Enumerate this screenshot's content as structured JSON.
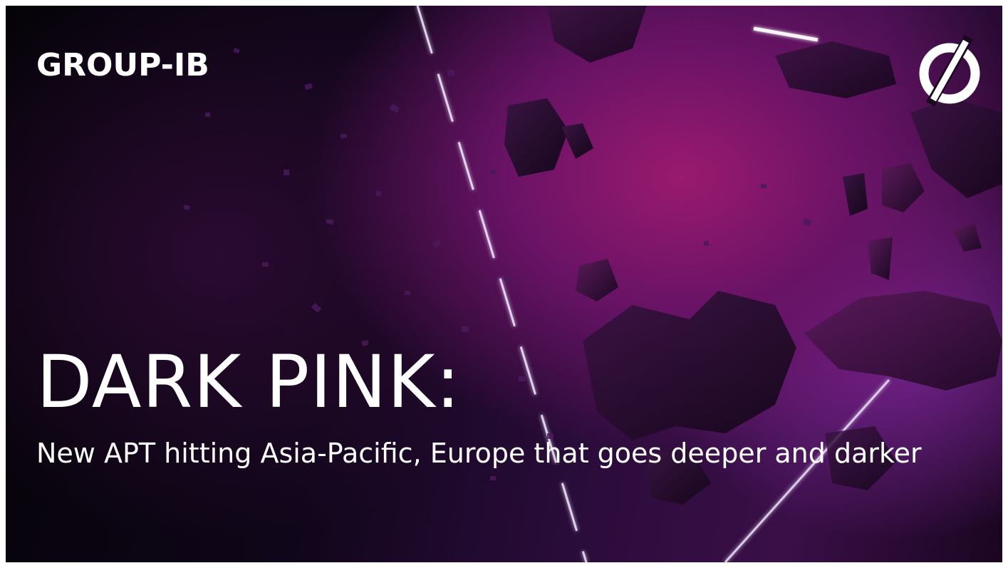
{
  "brand": {
    "wordmark": "GROUP-IB",
    "icon": "group-ib-logo-icon"
  },
  "headline": "DARK PINK:",
  "subheadline": "New APT hitting Asia-Pacific, Europe that goes deeper and darker",
  "colors": {
    "text": "#ffffff",
    "background_dark": "#050308",
    "accent_magenta": "#9a1a6e",
    "accent_purple": "#7a2494",
    "laser": "#f2e9ff"
  }
}
